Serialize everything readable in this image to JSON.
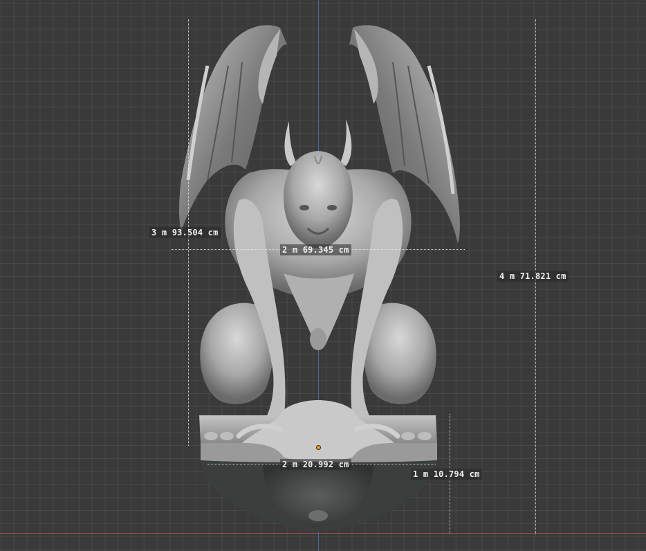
{
  "viewport": {
    "background": "#3a3a3a",
    "axis_y_color": "#4a6aa5",
    "axis_x_color": "#9a4a4a",
    "origin_color": "#f0a020",
    "model": "gargoyle-sculpt"
  },
  "measurements": {
    "left_height": "3 m 93.504 cm",
    "wing_width": "2 m 69.345 cm",
    "total_height": "4 m 71.821 cm",
    "base_width": "2 m 20.992 cm",
    "base_height": "1 m 10.794 cm"
  }
}
